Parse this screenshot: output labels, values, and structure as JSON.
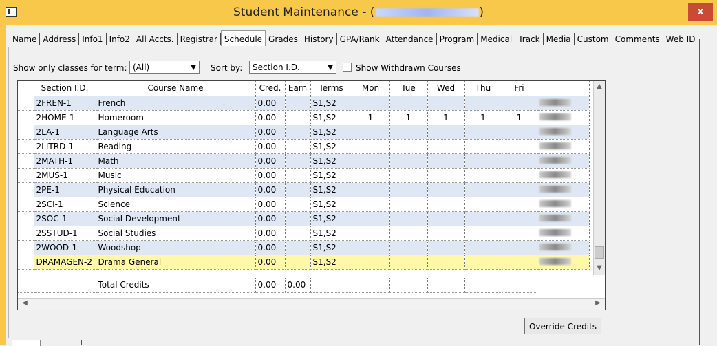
{
  "window": {
    "title": "Student Maintenance - (",
    "title_suffix": ")",
    "close_label": "x"
  },
  "tabs": [
    "Name",
    "Address",
    "Info1",
    "Info2",
    "All Accts.",
    "Registrar",
    "Schedule",
    "Grades",
    "History",
    "GPA/Rank",
    "Attendance",
    "Program",
    "Medical",
    "Track",
    "Media",
    "Custom",
    "Comments",
    "Web ID"
  ],
  "active_tab": "Schedule",
  "filters": {
    "term_label": "Show only classes for term:",
    "term_value": "(All)",
    "sort_label": "Sort by:",
    "sort_value": "Section I.D.",
    "withdrawn_label": "Show Withdrawn Courses"
  },
  "columns": [
    "Section I.D.",
    "Course Name",
    "Cred.",
    "Earn",
    "Terms",
    "Mon",
    "Tue",
    "Wed",
    "Thu",
    "Fri"
  ],
  "rows": [
    {
      "section": "2FREN-1",
      "course": "French",
      "cred": "0.00",
      "earn": "",
      "terms": "S1,S2",
      "mon": "",
      "tue": "",
      "wed": "",
      "thu": "",
      "fri": ""
    },
    {
      "section": "2HOME-1",
      "course": "Homeroom",
      "cred": "0.00",
      "earn": "",
      "terms": "S1,S2",
      "mon": "1",
      "tue": "1",
      "wed": "1",
      "thu": "1",
      "fri": "1"
    },
    {
      "section": "2LA-1",
      "course": "Language Arts",
      "cred": "0.00",
      "earn": "",
      "terms": "S1,S2",
      "mon": "",
      "tue": "",
      "wed": "",
      "thu": "",
      "fri": ""
    },
    {
      "section": "2LITRD-1",
      "course": "Reading",
      "cred": "0.00",
      "earn": "",
      "terms": "S1,S2",
      "mon": "",
      "tue": "",
      "wed": "",
      "thu": "",
      "fri": ""
    },
    {
      "section": "2MATH-1",
      "course": "Math",
      "cred": "0.00",
      "earn": "",
      "terms": "S1,S2",
      "mon": "",
      "tue": "",
      "wed": "",
      "thu": "",
      "fri": ""
    },
    {
      "section": "2MUS-1",
      "course": "Music",
      "cred": "0.00",
      "earn": "",
      "terms": "S1,S2",
      "mon": "",
      "tue": "",
      "wed": "",
      "thu": "",
      "fri": ""
    },
    {
      "section": "2PE-1",
      "course": "Physical Education",
      "cred": "0.00",
      "earn": "",
      "terms": "S1,S2",
      "mon": "",
      "tue": "",
      "wed": "",
      "thu": "",
      "fri": ""
    },
    {
      "section": "2SCI-1",
      "course": "Science",
      "cred": "0.00",
      "earn": "",
      "terms": "S1,S2",
      "mon": "",
      "tue": "",
      "wed": "",
      "thu": "",
      "fri": ""
    },
    {
      "section": "2SOC-1",
      "course": "Social Development",
      "cred": "0.00",
      "earn": "",
      "terms": "S1,S2",
      "mon": "",
      "tue": "",
      "wed": "",
      "thu": "",
      "fri": ""
    },
    {
      "section": "2SSTUD-1",
      "course": "Social Studies",
      "cred": "0.00",
      "earn": "",
      "terms": "S1,S2",
      "mon": "",
      "tue": "",
      "wed": "",
      "thu": "",
      "fri": ""
    },
    {
      "section": "2WOOD-1",
      "course": "Woodshop",
      "cred": "0.00",
      "earn": "",
      "terms": "S1,S2",
      "mon": "",
      "tue": "",
      "wed": "",
      "thu": "",
      "fri": ""
    },
    {
      "section": "DRAMAGEN-2",
      "course": "Drama General",
      "cred": "0.00",
      "earn": "",
      "terms": "S1,S2",
      "mon": "",
      "tue": "",
      "wed": "",
      "thu": "",
      "fri": ""
    }
  ],
  "totals": {
    "label": "Total Credits",
    "cred": "0.00",
    "earn": "0.00"
  },
  "buttons": {
    "override": "Override Credits"
  }
}
